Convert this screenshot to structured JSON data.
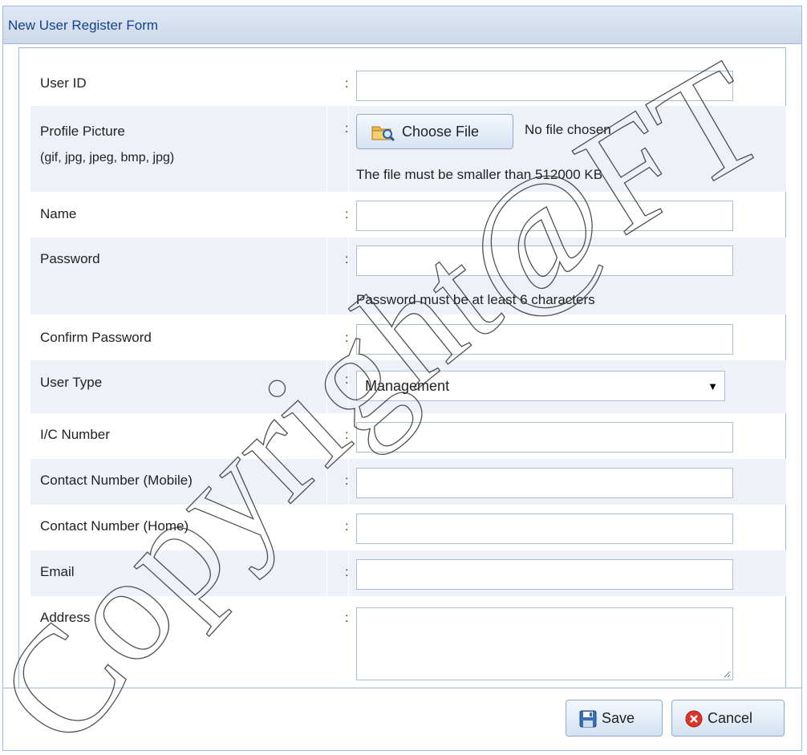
{
  "window": {
    "title": "New User Register Form"
  },
  "colon": ":",
  "fields": {
    "user_id": {
      "label": "User ID",
      "value": ""
    },
    "profile_picture": {
      "label": "Profile Picture",
      "sublabel": "(gif, jpg, jpeg, bmp, jpg)",
      "button_label": "Choose File",
      "status": "No file chosen",
      "hint": "The file must be smaller than 512000 KB"
    },
    "name": {
      "label": "Name",
      "value": ""
    },
    "password": {
      "label": "Password",
      "value": "",
      "hint": "Password must be at least 6 characters"
    },
    "confirm_password": {
      "label": "Confirm Password",
      "value": ""
    },
    "user_type": {
      "label": "User Type",
      "selected": "Management"
    },
    "ic_number": {
      "label": "I/C Number",
      "value": ""
    },
    "contact_mobile": {
      "label": "Contact Number (Mobile)",
      "value": ""
    },
    "contact_home": {
      "label": "Contact Number (Home)",
      "value": ""
    },
    "email": {
      "label": "Email",
      "value": ""
    },
    "address": {
      "label": "Address",
      "value": ""
    }
  },
  "footer": {
    "save_label": "Save",
    "cancel_label": "Cancel"
  },
  "watermark": {
    "text": "Copyright@FTSM"
  },
  "icons": {
    "folder": "folder-search-icon",
    "save": "floppy-disk-icon",
    "cancel": "cancel-x-icon",
    "dropdown": "dropdown-arrow-icon",
    "resize": "resize-grip-icon"
  },
  "colors": {
    "title_text": "#15428b",
    "border": "#99bbe8",
    "alt_row": "#eef1f8",
    "cancel_red": "#d9362b"
  }
}
